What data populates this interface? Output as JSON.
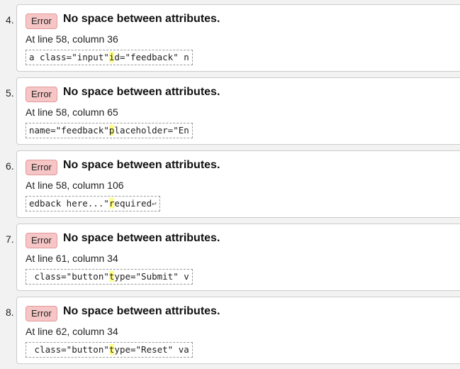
{
  "errors": [
    {
      "number": "4.",
      "type": "Error",
      "message": "No space between attributes.",
      "location": "At line 58, column 36",
      "extract": {
        "before": "a class=\"input\"",
        "highlight": "i",
        "after": "d=\"feedback\" n",
        "suffix": ""
      }
    },
    {
      "number": "5.",
      "type": "Error",
      "message": "No space between attributes.",
      "location": "At line 58, column 65",
      "extract": {
        "before": "name=\"feedback\"",
        "highlight": "p",
        "after": "laceholder=\"En",
        "suffix": ""
      }
    },
    {
      "number": "6.",
      "type": "Error",
      "message": "No space between attributes.",
      "location": "At line 58, column 106",
      "extract": {
        "before": "edback here...\"",
        "highlight": "r",
        "after": "equired",
        "suffix": "↩"
      }
    },
    {
      "number": "7.",
      "type": "Error",
      "message": "No space between attributes.",
      "location": "At line 61, column 34",
      "extract": {
        "before": " class=\"button\"",
        "highlight": "t",
        "after": "ype=\"Submit\" v",
        "suffix": ""
      }
    },
    {
      "number": "8.",
      "type": "Error",
      "message": "No space between attributes.",
      "location": "At line 62, column 34",
      "extract": {
        "before": " class=\"button\"",
        "highlight": "t",
        "after": "ype=\"Reset\" va",
        "suffix": ""
      }
    }
  ]
}
